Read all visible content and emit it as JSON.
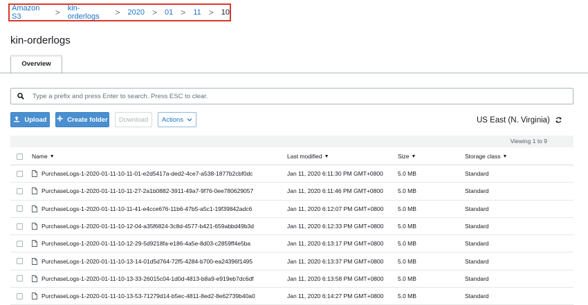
{
  "breadcrumb": {
    "items": [
      "Amazon S3",
      "kin-orderlogs",
      "2020",
      "01",
      "11"
    ],
    "current": "10",
    "separator": ">"
  },
  "page": {
    "title": "kin-orderlogs"
  },
  "tabs": [
    {
      "label": "Overview",
      "active": true
    }
  ],
  "search": {
    "placeholder": "Type a prefix and press Enter to search. Press ESC to clear.",
    "value": ""
  },
  "toolbar": {
    "upload": "Upload",
    "create_folder": "Create folder",
    "download": "Download",
    "actions": "Actions"
  },
  "region": "US East (N. Virginia)",
  "viewing": "Viewing 1 to 9",
  "table": {
    "columns": {
      "name": "Name",
      "modified": "Last modified",
      "size": "Size",
      "class": "Storage class"
    },
    "rows": [
      {
        "name": "PurchaseLogs-1-2020-01-11-10-11-01-e2d5417a-ded2-4ce7-a538-1877b2cbf0dc",
        "modified": "Jan 11, 2020 6:11:30 PM GMT+0800",
        "size": "5.0 MB",
        "class": "Standard"
      },
      {
        "name": "PurchaseLogs-1-2020-01-11-10-11-27-2a1b0882-3911-49a7-9f76-0ee780629057",
        "modified": "Jan 11, 2020 6:11:46 PM GMT+0800",
        "size": "5.0 MB",
        "class": "Standard"
      },
      {
        "name": "PurchaseLogs-1-2020-01-11-10-11-41-e4cce676-11b6-47b5-a5c1-19f39842adc6",
        "modified": "Jan 11, 2020 6:12:07 PM GMT+0800",
        "size": "5.0 MB",
        "class": "Standard"
      },
      {
        "name": "PurchaseLogs-1-2020-01-11-10-12-04-a35f6824-3c8d-4577-b421-659abbd49b3d",
        "modified": "Jan 11, 2020 6:12:33 PM GMT+0800",
        "size": "5.0 MB",
        "class": "Standard"
      },
      {
        "name": "PurchaseLogs-1-2020-01-11-10-12-29-5d9218fa-e186-4a5e-8d03-c2859ff4e5ba",
        "modified": "Jan 11, 2020 6:13:17 PM GMT+0800",
        "size": "5.0 MB",
        "class": "Standard"
      },
      {
        "name": "PurchaseLogs-1-2020-01-11-10-13-14-01d5d764-72f5-4284-b700-ea24396f1495",
        "modified": "Jan 11, 2020 6:13:37 PM GMT+0800",
        "size": "5.0 MB",
        "class": "Standard"
      },
      {
        "name": "PurchaseLogs-1-2020-01-11-10-13-33-26015c04-1d0d-4813-b8a9-e919eb7dc6df",
        "modified": "Jan 11, 2020 6:13:58 PM GMT+0800",
        "size": "5.0 MB",
        "class": "Standard"
      },
      {
        "name": "PurchaseLogs-1-2020-01-11-10-13-53-71279d14-b5ec-4811-8ed2-8e62739b40a0",
        "modified": "Jan 11, 2020 6:14:27 PM GMT+0800",
        "size": "5.0 MB",
        "class": "Standard"
      }
    ]
  },
  "colors": {
    "link": "#1a73c8",
    "primary": "#4a8fcf",
    "highlight": "#d9362b"
  },
  "icons": [
    "search-icon",
    "upload-icon",
    "plus-icon",
    "chevron-down-icon",
    "refresh-icon",
    "file-icon",
    "sort-caret-icon"
  ]
}
